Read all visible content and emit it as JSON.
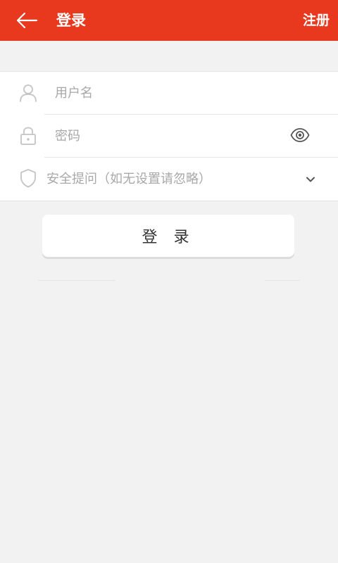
{
  "header": {
    "title": "登录",
    "register_label": "注册"
  },
  "form": {
    "username_placeholder": "用户名",
    "password_placeholder": "密码",
    "security_question_label": "安全提问（如无设置请忽略）"
  },
  "actions": {
    "login_label": "登 录"
  },
  "icons": {
    "back": "arrow-left-icon",
    "user": "user-icon",
    "lock": "lock-icon",
    "eye": "eye-icon",
    "shield": "shield-icon",
    "chevron": "chevron-down-icon"
  },
  "colors": {
    "brand": "#e8391f",
    "background": "#f2f2f2",
    "placeholder": "#a8a8a8"
  }
}
